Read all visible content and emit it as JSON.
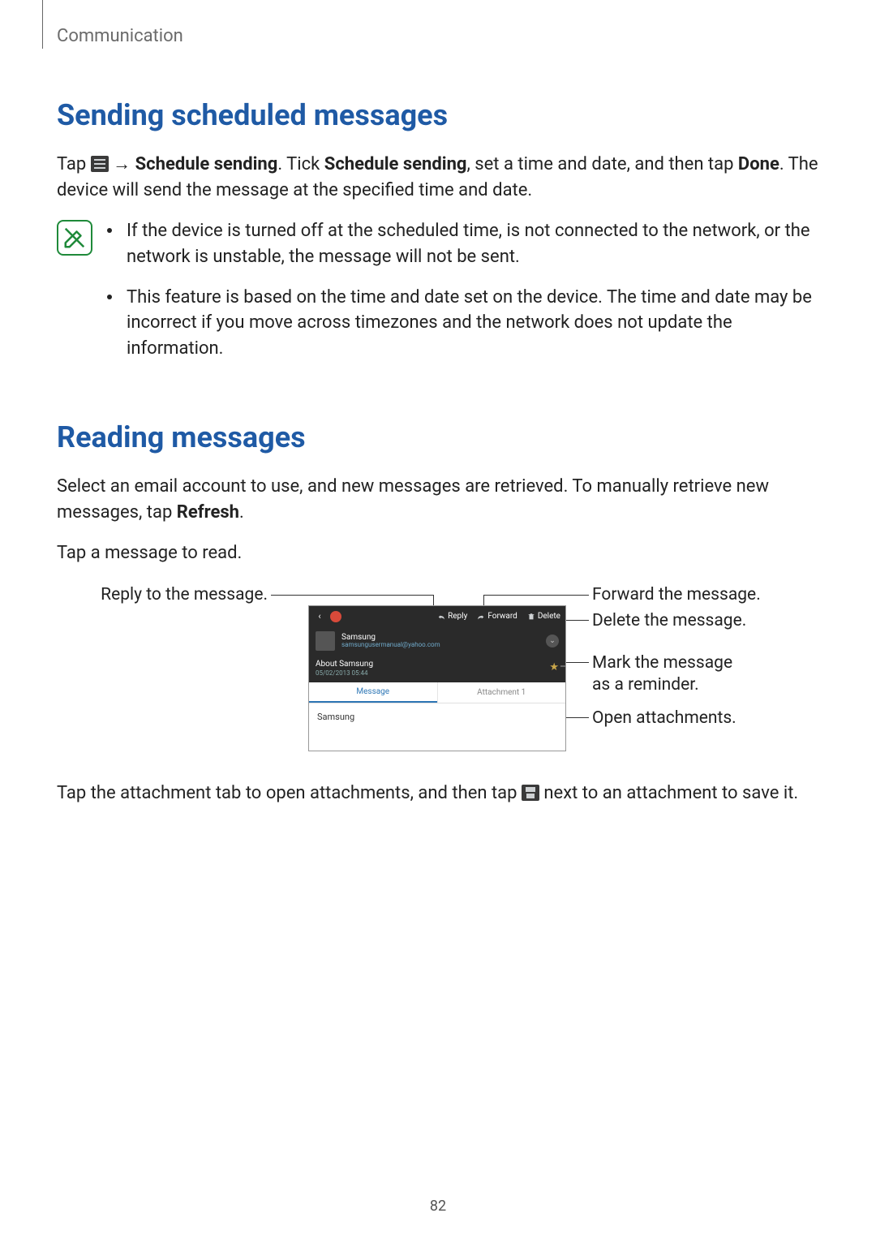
{
  "page": {
    "running_head": "Communication",
    "page_number": "82"
  },
  "sec1": {
    "heading": "Sending scheduled messages",
    "p1_a": "Tap ",
    "p1_b": " → ",
    "p1_bold1": "Schedule sending",
    "p1_c": ". Tick ",
    "p1_bold2": "Schedule sending",
    "p1_d": ", set a time and date, and then tap ",
    "p1_bold3": "Done",
    "p1_e": ". The device will send the message at the specified time and date.",
    "note1": "If the device is turned off at the scheduled time, is not connected to the network, or the network is unstable, the message will not be sent.",
    "note2": "This feature is based on the time and date set on the device. The time and date may be incorrect if you move across timezones and the network does not update the information."
  },
  "sec2": {
    "heading": "Reading messages",
    "p1_a": "Select an email account to use, and new messages are retrieved. To manually retrieve new messages, tap ",
    "p1_bold": "Refresh",
    "p1_b": ".",
    "p2": "Tap a message to read.",
    "p3_a": "Tap the attachment tab to open attachments, and then tap ",
    "p3_b": " next to an attachment to save it."
  },
  "callouts": {
    "reply": "Reply to the message.",
    "forward": "Forward the message.",
    "delete": "Delete the message.",
    "mark_line1": "Mark the message",
    "mark_line2": "as a reminder.",
    "open": "Open attachments."
  },
  "phone": {
    "reply": "Reply",
    "forward": "Forward",
    "delete": "Delete",
    "sender_name": "Samsung",
    "sender_email": "samsungusermanual@yahoo.com",
    "subject": "About Samsung",
    "date": "05/02/2013 05:44",
    "tab_message": "Message",
    "tab_attachment": "Attachment 1",
    "body": "Samsung"
  }
}
